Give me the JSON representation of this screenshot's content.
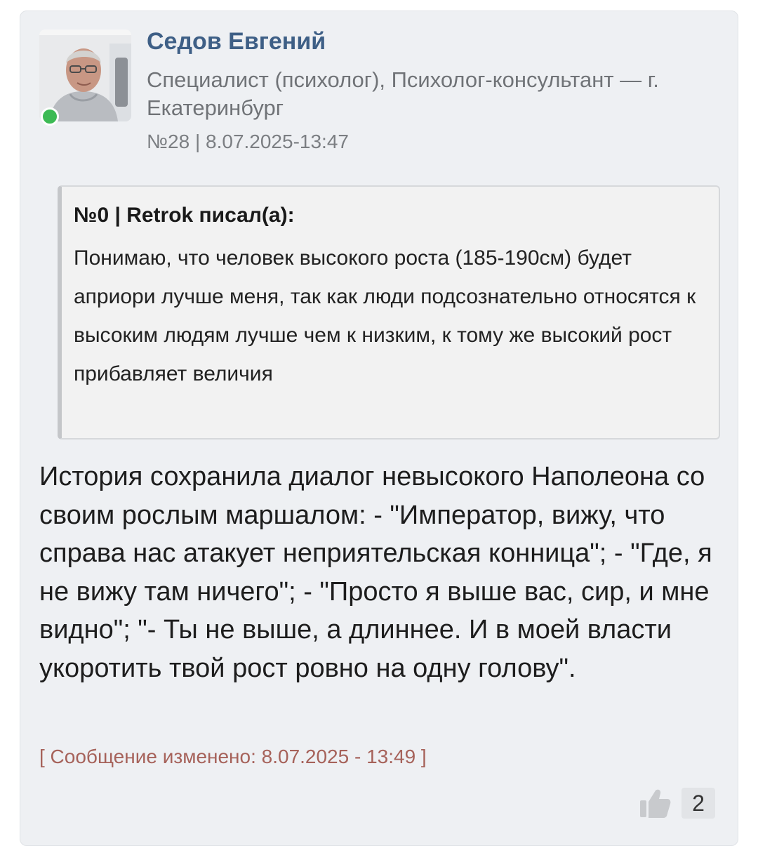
{
  "post": {
    "author": "Седов Евгений",
    "role": "Специалист (психолог), Психолог-консультант — г. Екатеринбург",
    "number_date": "№28 | 8.07.2025-13:47",
    "avatar_icon": "user-photo",
    "online": true,
    "quote": {
      "header": "№0 | Retrok писал(а):",
      "text": "Понимаю, что человек высокого роста (185-190см) будет априори лучше меня, так как люди подсознательно относятся к высоким людям лучше чем к низким, к тому же высокий рост прибавляет величия"
    },
    "body": "История сохранила диалог невысокого Наполеона со своим рослым маршалом: - \"Император, вижу, что справа нас атакует неприятельская конница\"; - \"Где, я не вижу там ничего\"; - \"Просто я выше вас, сир, и мне видно\"; \"- Ты не выше, а длиннее. И в моей власти укоротить твой рост ровно на одну голову\".",
    "edited_note": "[ Сообщение изменено: 8.07.2025 - 13:49 ]",
    "likes": {
      "icon": "thumbs-up-icon",
      "count": "2"
    }
  },
  "colors": {
    "author": "#3e5f86",
    "online": "#3cba54",
    "edited": "#a6625a",
    "card_bg": "#eef0f3"
  }
}
